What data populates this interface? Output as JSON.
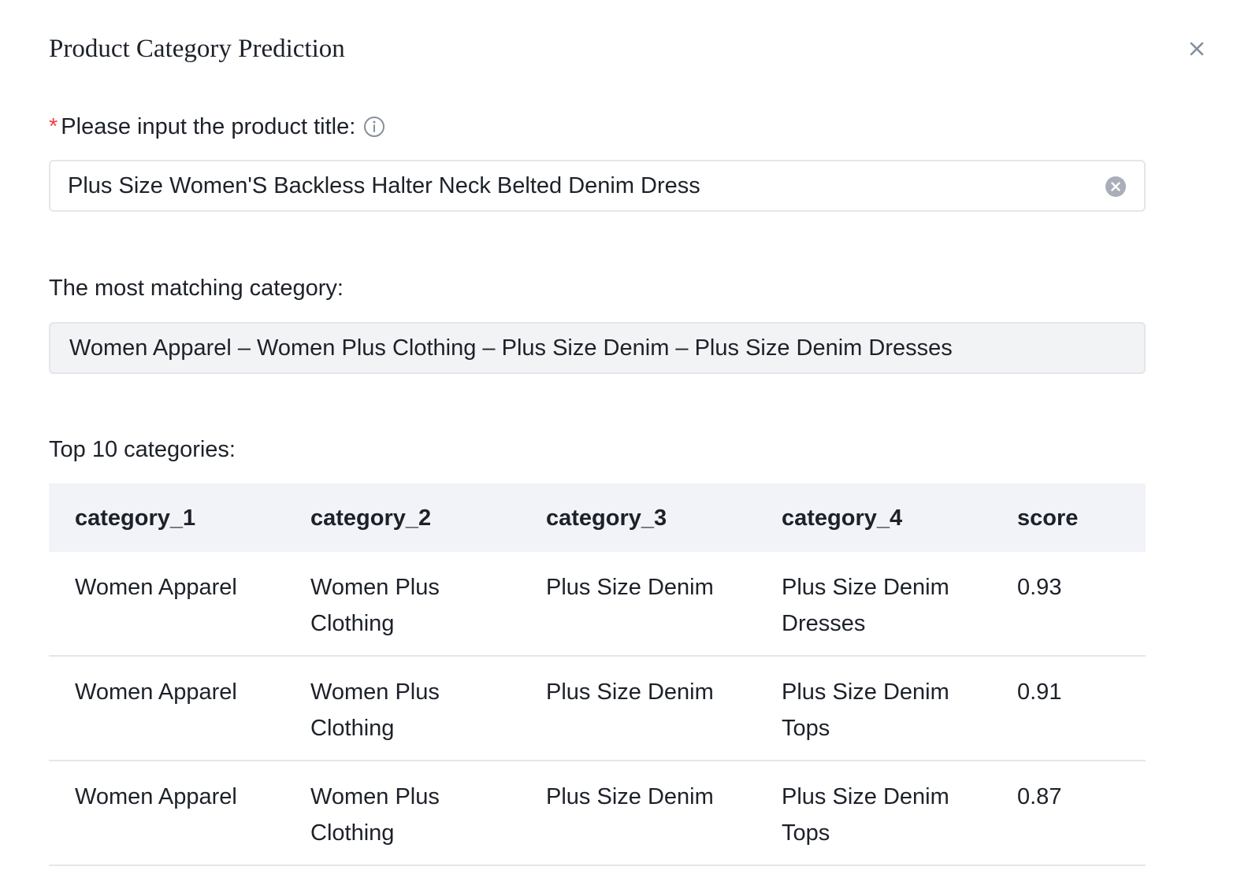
{
  "dialog": {
    "title": "Product Category Prediction",
    "close_icon": "close-icon"
  },
  "form": {
    "required_mark": "*",
    "label": "Please input the product title:",
    "info_icon": "info-icon",
    "input_value": "Plus Size Women'S Backless Halter Neck Belted Denim Dress",
    "clear_icon": "clear-icon"
  },
  "best_match": {
    "label": "The most matching category:",
    "value": "Women Apparel – Women Plus Clothing – Plus Size Denim – Plus Size Denim Dresses"
  },
  "top_categories": {
    "label": "Top 10 categories:",
    "columns": [
      "category_1",
      "category_2",
      "category_3",
      "category_4",
      "score"
    ],
    "rows": [
      [
        "Women Apparel",
        "Women Plus Clothing",
        "Plus Size Denim",
        "Plus Size Denim Dresses",
        "0.93"
      ],
      [
        "Women Apparel",
        "Women Plus Clothing",
        "Plus Size Denim",
        "Plus Size Denim Tops",
        "0.91"
      ],
      [
        "Women Apparel",
        "Women Plus Clothing",
        "Plus Size Denim",
        "Plus Size Denim Tops",
        "0.87"
      ]
    ]
  },
  "colors": {
    "required": "#f53f3f",
    "text": "#1d2129",
    "border": "#e5e6eb",
    "readonly_bg": "#f2f3f5",
    "table_header_bg": "#f2f3f8",
    "icon_gray": "#86909c"
  }
}
